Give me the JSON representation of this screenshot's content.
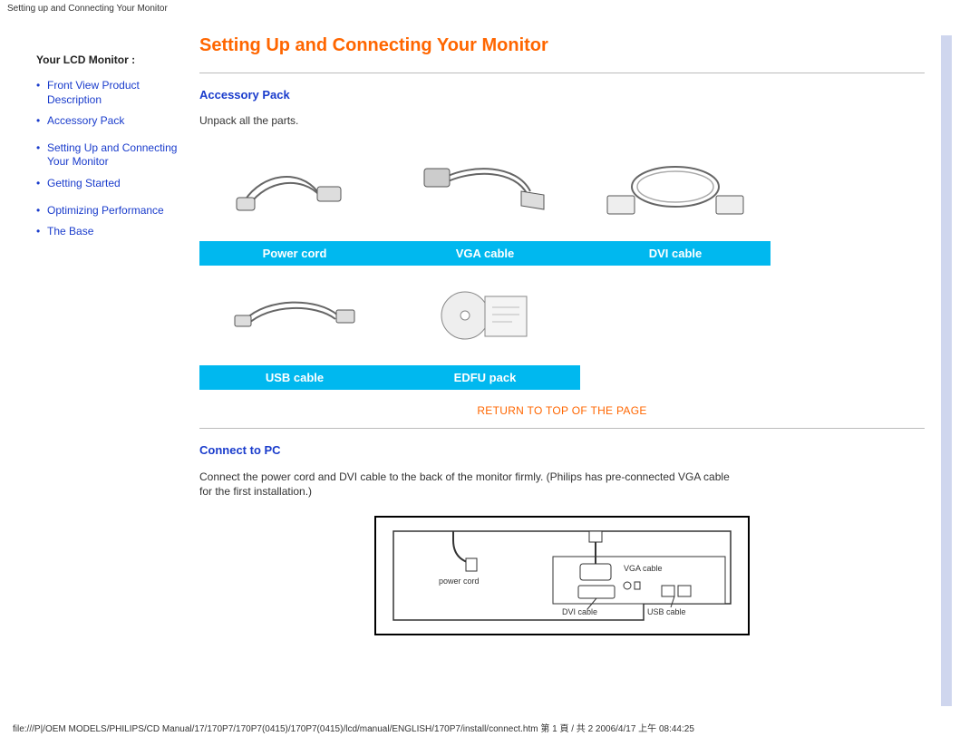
{
  "header_title": "Setting up and Connecting Your Monitor",
  "sidebar": {
    "title": "Your LCD Monitor :",
    "items": [
      "Front View Product Description",
      "Accessory Pack",
      "Setting Up and Connecting Your Monitor",
      "Getting Started",
      "Optimizing Performance",
      "The Base"
    ]
  },
  "main": {
    "title": "Setting Up and Connecting Your Monitor",
    "accessory": {
      "heading": "Accessory Pack",
      "instruction": "Unpack all the parts.",
      "row1": [
        "Power cord",
        "VGA cable",
        "DVI cable"
      ],
      "row2": [
        "USB cable",
        "EDFU pack"
      ]
    },
    "return_link": "RETURN TO TOP OF THE PAGE",
    "connect": {
      "heading": "Connect to PC",
      "para": "Connect the power cord and DVI cable to the back of the monitor firmly. (Philips has pre-connected VGA cable for the first installation.)"
    },
    "diagram_labels": {
      "power": "power cord",
      "vga": "VGA cable",
      "dvi": "DVI cable",
      "usb": "USB cable"
    }
  },
  "footer_path": "file:///P|/OEM MODELS/PHILIPS/CD Manual/17/170P7/170P7(0415)/170P7(0415)/lcd/manual/ENGLISH/170P7/install/connect.htm 第 1 頁 / 共 2 2006/4/17 上午 08:44:25"
}
